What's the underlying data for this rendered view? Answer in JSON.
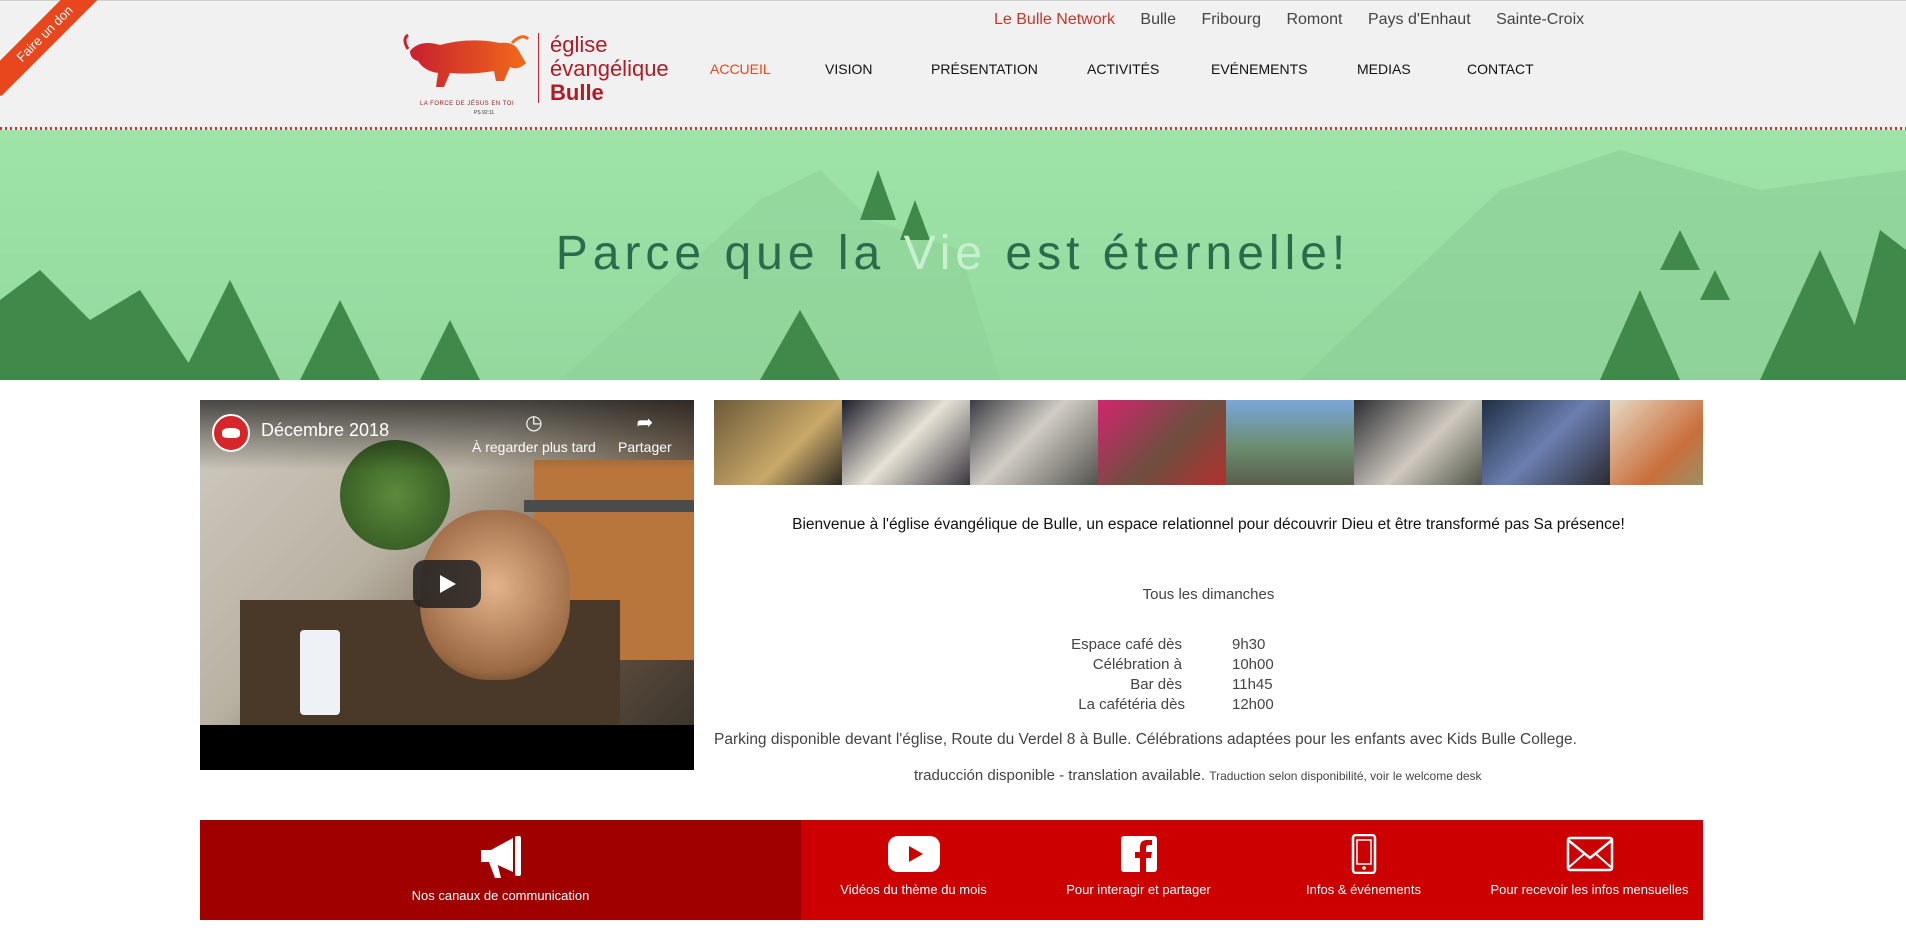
{
  "donate_ribbon": "Faire un don",
  "logo": {
    "line1": "église",
    "line2": "évangélique",
    "line3": "Bulle",
    "tagline": "LA FORCE DE JÉSUS EN TOI",
    "verse": "PS 92:11"
  },
  "top_nav": {
    "items": [
      "Le Bulle Network",
      "Bulle",
      "Fribourg",
      "Romont",
      "Pays d'Enhaut",
      "Sainte-Croix"
    ]
  },
  "main_nav": {
    "items": [
      "ACCUEIL",
      "VISION",
      "PRÉSENTATION",
      "ACTIVITÉS",
      "EVÉNEMENTS",
      "MEDIAS",
      "CONTACT"
    ],
    "active_index": 0
  },
  "hero": {
    "text_before": "Parce que la ",
    "text_highlight": "Vie",
    "text_after": " est éternelle!"
  },
  "video": {
    "title": "Décembre 2018",
    "watch_later": "À regarder plus tard",
    "share": "Partager"
  },
  "welcome": {
    "headline": "Bienvenue à l'église évangélique de Bulle, un espace relationnel pour découvrir Dieu et être transformé pas Sa présence!",
    "sunday": "Tous les dimanches",
    "schedule": [
      {
        "label": "Espace café dès",
        "time": "9h30"
      },
      {
        "label": "Célébration à",
        "time": "10h00"
      },
      {
        "label": "Bar dès",
        "time": "11h45"
      },
      {
        "label": "La cafétéria dès",
        "time": "12h00"
      }
    ],
    "parking": "Parking disponible devant l'église, Route du Verdel 8 à Bulle. Célébrations adaptées pour les enfants avec Kids Bulle College.",
    "translation": "traducción disponible - translation available.",
    "translation_small": "Traduction selon disponibilité, voir le welcome desk"
  },
  "footer": {
    "items": [
      {
        "label": "Nos canaux de communication",
        "icon": "megaphone-icon"
      },
      {
        "label": "Vidéos du thème du mois",
        "icon": "youtube-icon"
      },
      {
        "label": "Pour interagir et partager",
        "icon": "facebook-icon"
      },
      {
        "label": "Infos & événements",
        "icon": "phone-icon"
      },
      {
        "label": "Pour recevoir les infos mensuelles",
        "icon": "envelope-icon"
      }
    ]
  },
  "colors": {
    "accent": "#e8461d",
    "brand_red": "#cc0000",
    "brand_dark_red": "#a10000",
    "hero_green": "#9ee3a8"
  }
}
